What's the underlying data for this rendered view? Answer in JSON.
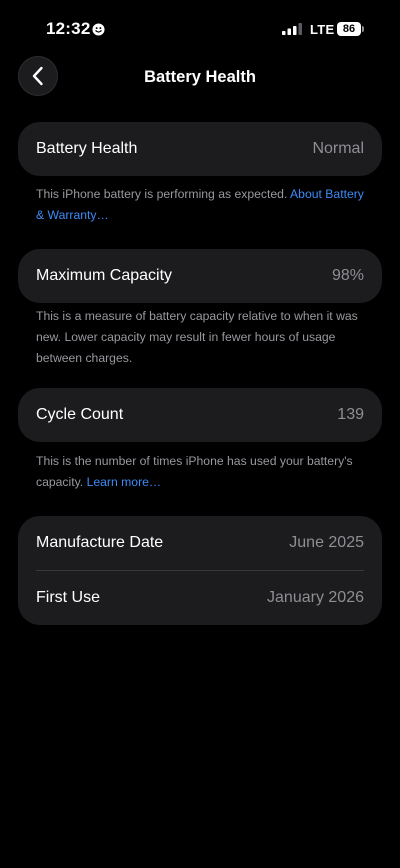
{
  "status_bar": {
    "time": "12:32",
    "network": "LTE",
    "battery_level": "86"
  },
  "nav": {
    "title": "Battery Health",
    "back_icon": "chevron-left-icon"
  },
  "battery_health": {
    "label": "Battery Health",
    "value": "Normal",
    "note_text": "This iPhone battery is performing as expected.",
    "note_link": "About Battery & Warranty…"
  },
  "max_capacity": {
    "label": "Maximum Capacity",
    "value": "98%",
    "note_text": "This is a measure of battery capacity relative to when it was new. Lower capacity may result in fewer hours of usage between charges."
  },
  "cycle_count": {
    "label": "Cycle Count",
    "value": "139",
    "note_text": "This is the number of times iPhone has used your battery's capacity.",
    "note_link": "Learn more…"
  },
  "dates": {
    "manufacture_label": "Manufacture Date",
    "manufacture_value": "June 2025",
    "first_use_label": "First Use",
    "first_use_value": "January 2026"
  },
  "colors": {
    "background": "#000000",
    "card": "#1c1c1e",
    "secondary_text": "#8e8e93",
    "link": "#3d8bf7"
  }
}
